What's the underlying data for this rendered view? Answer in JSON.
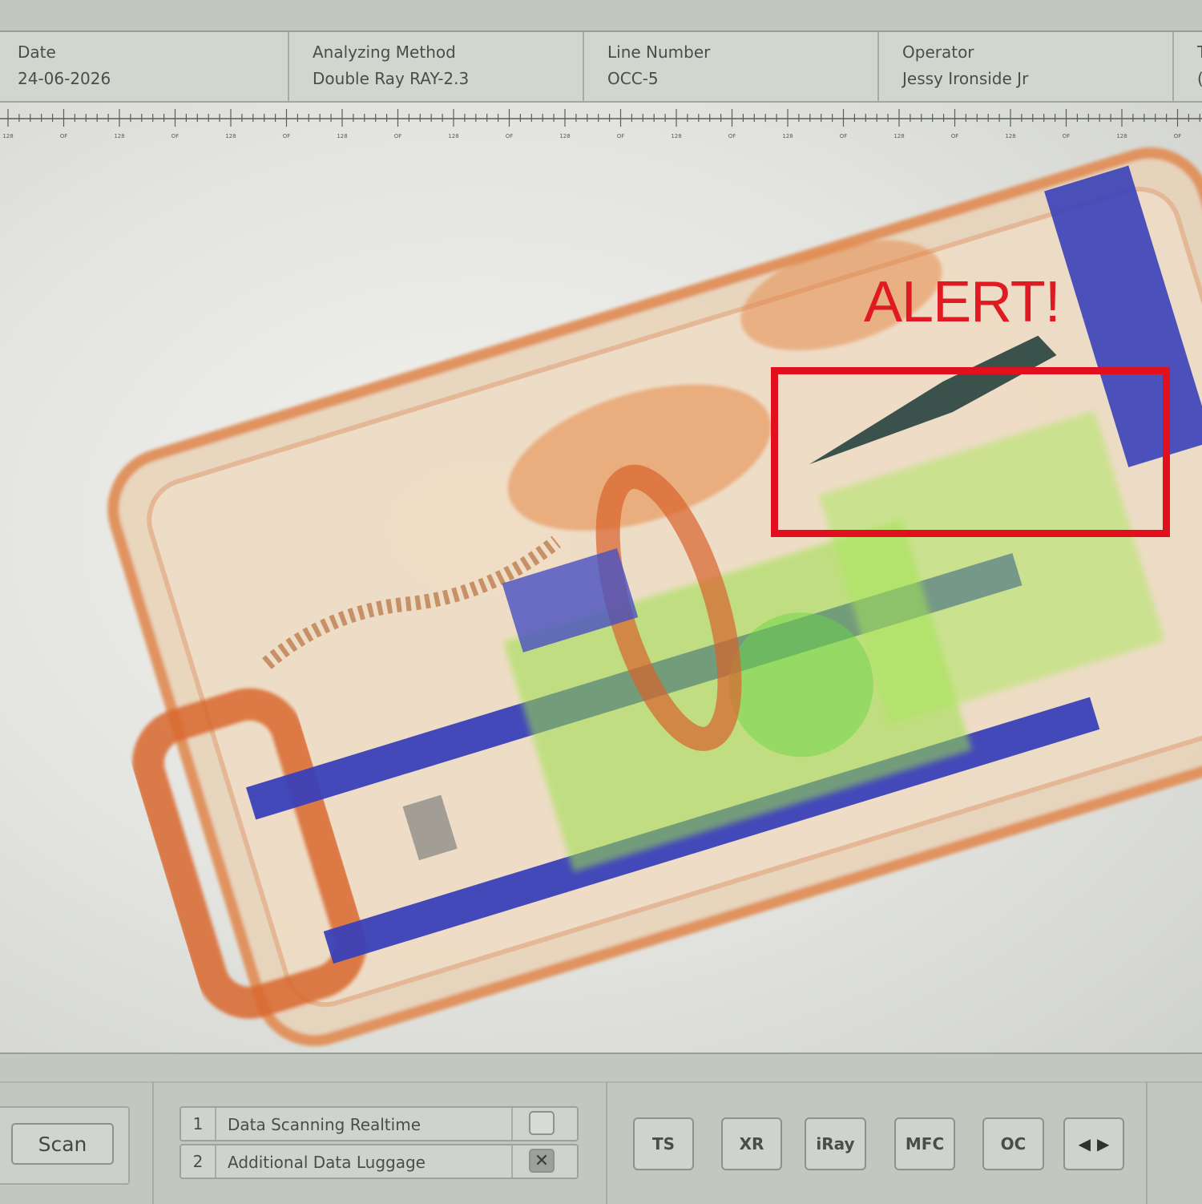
{
  "header": {
    "fields": [
      {
        "label": "Date",
        "value": "24-06-2026"
      },
      {
        "label": "Analyzing Method",
        "value": "Double Ray RAY-2.3"
      },
      {
        "label": "Line Number",
        "value": "OCC-5"
      },
      {
        "label": "Operator",
        "value": "Jessy Ironside Jr"
      },
      {
        "label": "T",
        "value": "("
      }
    ]
  },
  "scan": {
    "alert_text": "ALERT!",
    "alert_color": "#e2101f"
  },
  "ruler": {
    "labels": [
      "128",
      "OF",
      "128",
      "OF",
      "128",
      "OF",
      "128",
      "OF",
      "128",
      "OF",
      "128",
      "OF",
      "128",
      "OF",
      "128",
      "OF",
      "128",
      "OF",
      "128",
      "OF",
      "128",
      "OF"
    ]
  },
  "controls": {
    "scan_button": "Scan",
    "rows": [
      {
        "num": "1",
        "label": "Data Scanning Realtime",
        "checked": false
      },
      {
        "num": "2",
        "label": "Additional Data Luggage",
        "checked": true,
        "mark": "✕"
      }
    ],
    "tools": [
      "TS",
      "XR",
      "iRay",
      "MFC",
      "OC"
    ],
    "nav": {
      "prev": "◀",
      "next": "▶"
    }
  },
  "icons": {
    "prev": "left-triangle-icon",
    "next": "right-triangle-icon",
    "check": "x-mark-icon"
  }
}
